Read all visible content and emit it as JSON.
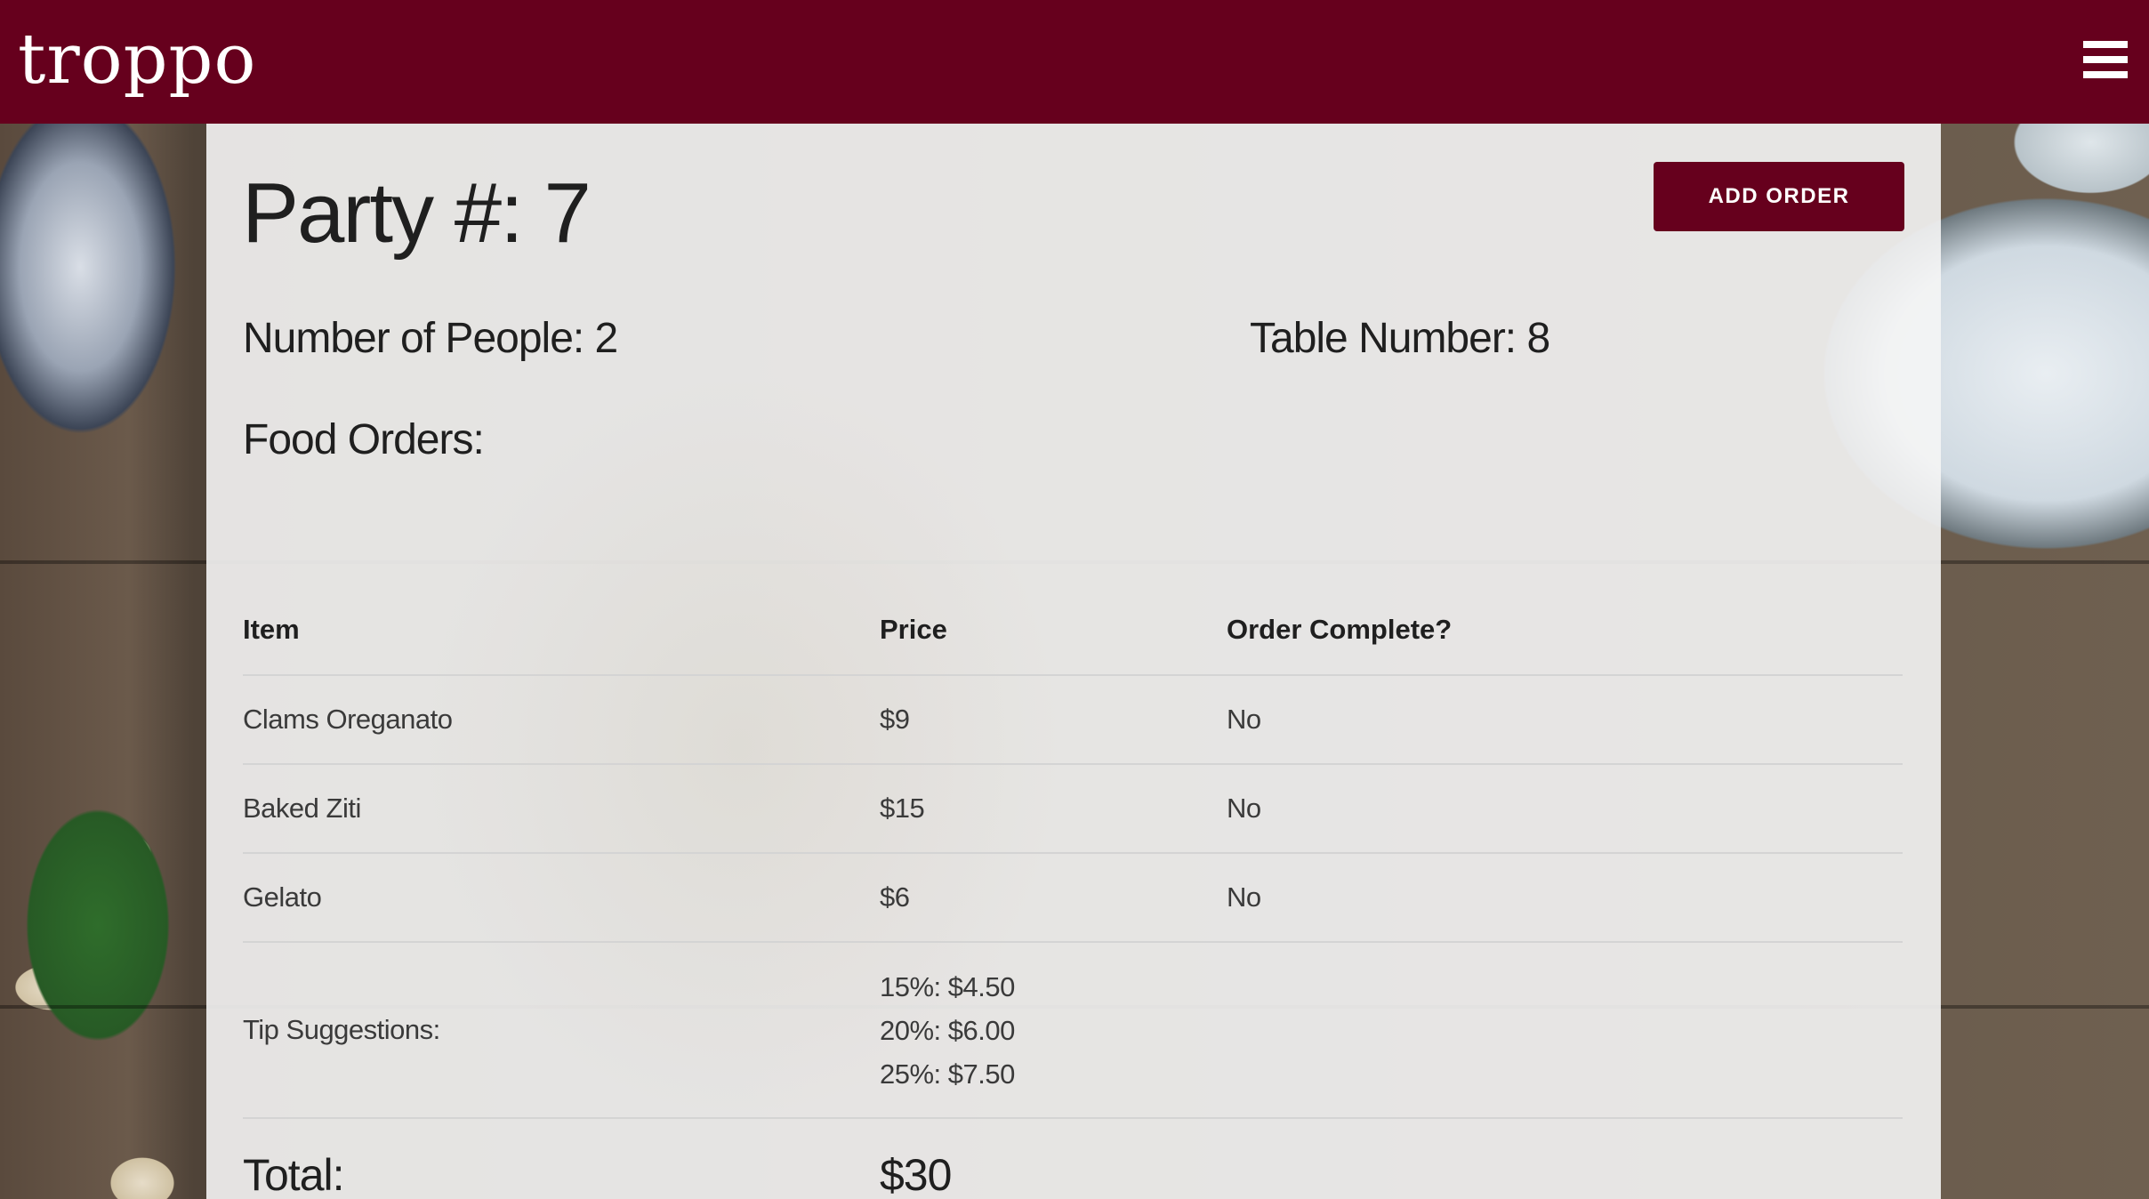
{
  "app": {
    "logo": "troppo",
    "menu_icon": "hamburger-menu-icon",
    "brand_color": "#66001d"
  },
  "party": {
    "title": "Party #: 7",
    "add_order_label": "ADD ORDER",
    "number_of_people": "Number of People: 2",
    "table_number": "Table Number: 8",
    "food_orders_heading": "Food Orders:"
  },
  "table": {
    "headers": [
      "Item",
      "Price",
      "Order Complete?"
    ],
    "rows": [
      {
        "item": "Clams Oreganato",
        "price": "$9",
        "complete": "No"
      },
      {
        "item": "Baked Ziti",
        "price": "$15",
        "complete": "No"
      },
      {
        "item": "Gelato",
        "price": "$6",
        "complete": "No"
      }
    ],
    "tip": {
      "label": "Tip Suggestions:",
      "lines": [
        "15%: $4.50",
        "20%: $6.00",
        "25%: $7.50"
      ]
    },
    "total": {
      "label": "Total:",
      "value": "$30"
    }
  }
}
